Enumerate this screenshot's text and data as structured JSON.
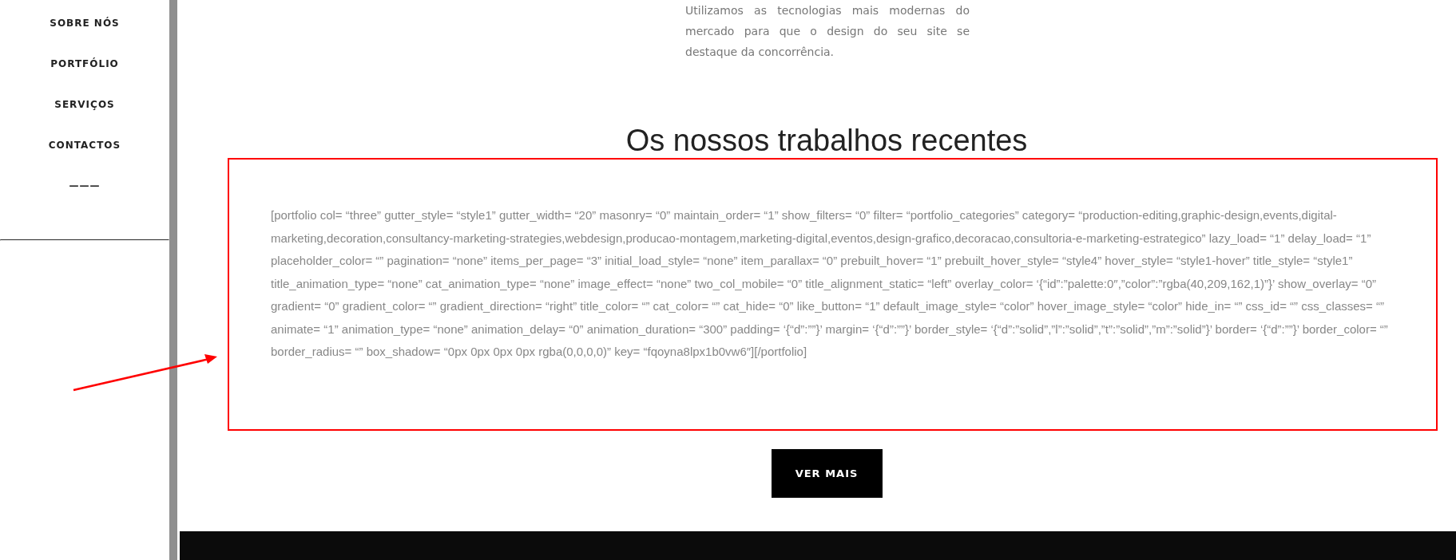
{
  "sidebar": {
    "items": [
      {
        "label": "SOBRE NÓS"
      },
      {
        "label": "PORTFÓLIO"
      },
      {
        "label": "SERVIÇOS"
      },
      {
        "label": "CONTACTOS"
      },
      {
        "label": "———"
      }
    ]
  },
  "intro": {
    "text": "Utilizamos as tecnologias mais modernas do mercado para que o design do seu site se destaque da concorrência."
  },
  "section": {
    "heading": "Os nossos trabalhos recentes",
    "shortcode": "[portfolio col= “three” gutter_style= “style1” gutter_width= “20” masonry= “0” maintain_order= “1” show_filters= “0” filter= “portfolio_categories” category= “production-editing,graphic-design,events,digital-marketing,decoration,consultancy-marketing-strategies,webdesign,producao-montagem,marketing-digital,eventos,design-grafico,decoracao,consultoria-e-marketing-estrategico” lazy_load= “1” delay_load= “1” placeholder_color= “” pagination= “none” items_per_page= “3” initial_load_style= “none” item_parallax= “0” prebuilt_hover= “1” prebuilt_hover_style= “style4” hover_style= “style1-hover” title_style= “style1” title_animation_type= “none” cat_animation_type= “none” image_effect= “none” two_col_mobile= “0” title_alignment_static= “left” overlay_color= ‘{“id”:”palette:0″,”color”:”rgba(40,209,162,1)”}’ show_overlay= “0” gradient= “0” gradient_color= “” gradient_direction= “right” title_color= “” cat_color= “” cat_hide= “0” like_button= “1” default_image_style= “color” hover_image_style= “color” hide_in= “” css_id= “” css_classes= “” animate= “1” animation_type= “none” animation_delay= “0” animation_duration= “300” padding= ‘{“d”:””}’ margin= ‘{“d”:””}’ border_style= ‘{“d”:”solid”,”l”:”solid”,”t”:”solid”,”m”:”solid”}’ border= ‘{“d”:””}’ border_color= “” border_radius= “” box_shadow= “0px 0px 0px 0px rgba(0,0,0,0)” key= “fqoyna8lpx1b0vw6″][/portfolio]",
    "button": "VER MAIS"
  }
}
